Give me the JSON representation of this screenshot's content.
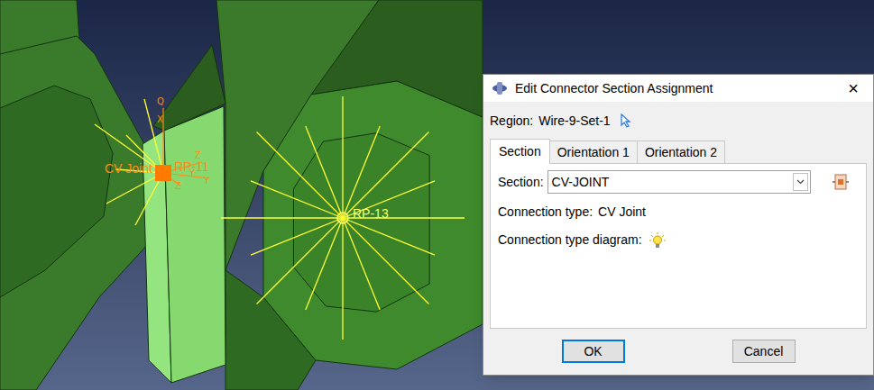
{
  "viewport": {
    "labels": [
      {
        "text": "CV Joint",
        "color": "#ff8c1a"
      },
      {
        "text": "RP-11",
        "color": "#ff8c1a"
      },
      {
        "text": "RP-13",
        "color": "#ffff66"
      }
    ],
    "axis_labels": [
      "Q",
      "X",
      "Z",
      "Y",
      "Z",
      "Y"
    ]
  },
  "dialog": {
    "title": "Edit Connector Section Assignment",
    "close": "×",
    "region": {
      "label": "Region:",
      "value": "Wire-9-Set-1"
    },
    "tabs": [
      {
        "label": "Section",
        "selected": true
      },
      {
        "label": "Orientation 1",
        "selected": false
      },
      {
        "label": "Orientation 2",
        "selected": false
      }
    ],
    "section": {
      "label": "Section:",
      "value": "CV-JOINT"
    },
    "connection_type": {
      "label": "Connection type:",
      "value": "CV Joint"
    },
    "diagram": {
      "label": "Connection type diagram:"
    },
    "buttons": [
      {
        "label": "OK",
        "default": true
      },
      {
        "label": "Cancel",
        "default": false
      }
    ]
  }
}
